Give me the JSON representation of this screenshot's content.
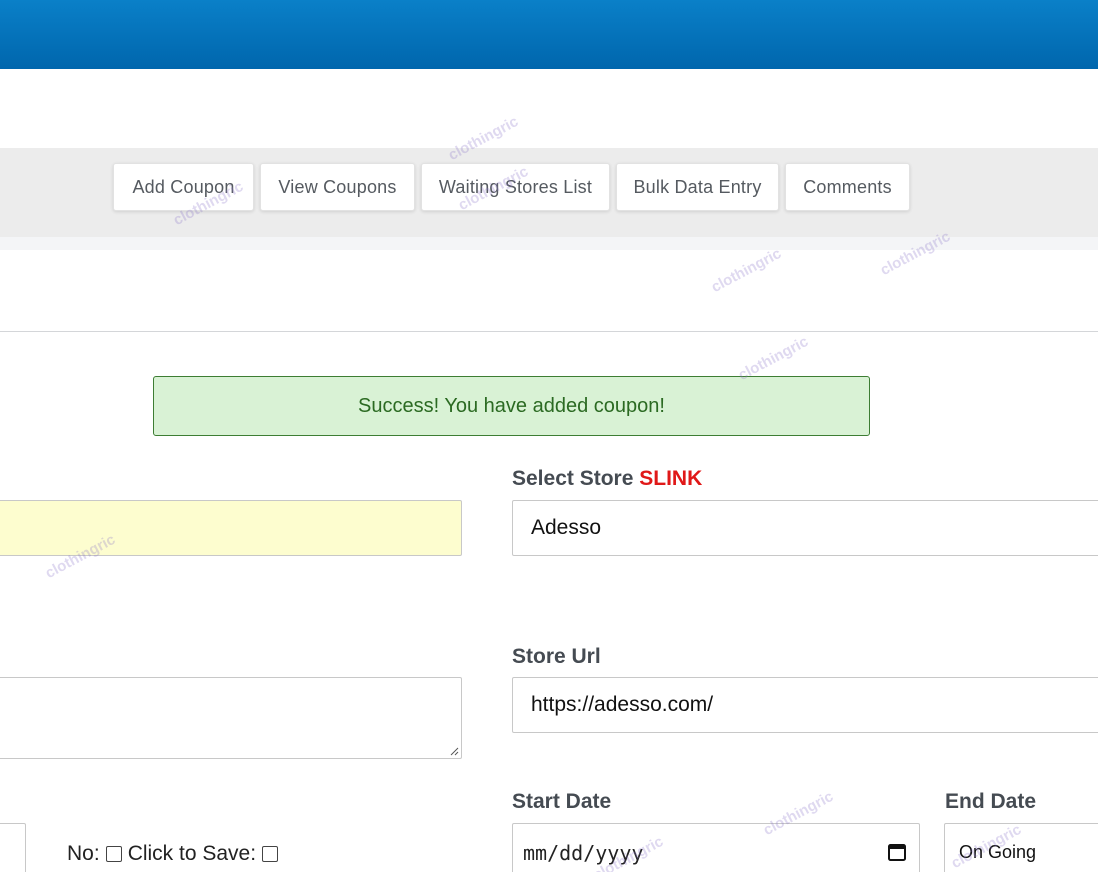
{
  "nav": {
    "buttons": [
      {
        "label": "Add Coupon"
      },
      {
        "label": "View Coupons"
      },
      {
        "label": "Waiting Stores List"
      },
      {
        "label": "Bulk Data Entry"
      },
      {
        "label": "Comments"
      }
    ]
  },
  "alert": {
    "message": "Success! You have added coupon!"
  },
  "form": {
    "select_store": {
      "label": "Select Store",
      "accent": "SLINK",
      "value": "Adesso"
    },
    "store_url": {
      "label": "Store Url",
      "value": "https://adesso.com/"
    },
    "start_date": {
      "label": "Start Date",
      "placeholder": "mm/dd/yyyy"
    },
    "end_date": {
      "label": "End Date",
      "value": "On Going"
    },
    "options": {
      "no_label": "No:",
      "save_label": "Click to Save:"
    }
  },
  "watermark": "clothingric",
  "colors": {
    "topbar": "#0072bb",
    "alert_bg": "#d9f2d5",
    "alert_text": "#2b6a22",
    "accent_red": "#e01818",
    "highlight_field": "#fdfdcf"
  }
}
